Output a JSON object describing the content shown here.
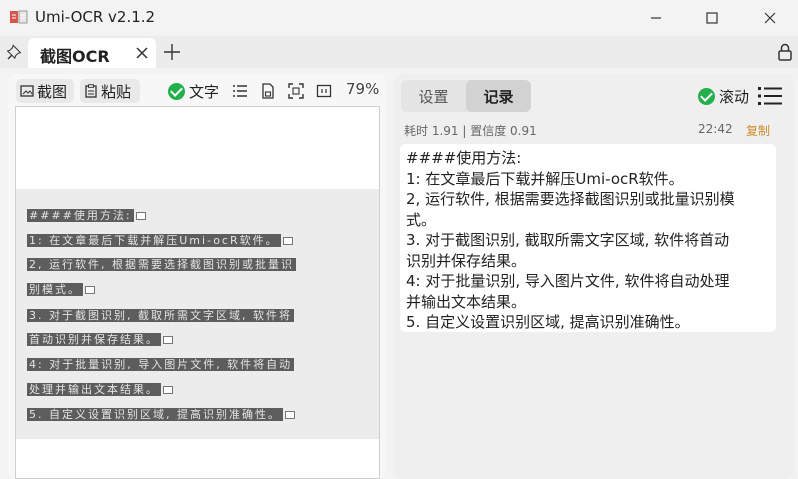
{
  "window": {
    "title": "Umi-OCR v2.1.2"
  },
  "tab": {
    "label": "截图OCR"
  },
  "left": {
    "capture_label": "截图",
    "paste_label": "粘贴",
    "text_label": "文字",
    "zoom": "79%",
    "image_lines": [
      "####使用方法:",
      "1: 在文章最后下载并解压Umi-ocR软件。",
      "2, 运行软件, 根据需要选择截图识别或批量识",
      "别模式。",
      "3. 对于截图识别, 截取所需文字区域, 软件将",
      "首动识别并保存结果。",
      "4: 对于批量识别, 导入图片文件, 软件将自动",
      "处理并输出文本结果。",
      "5. 自定义设置识别区域, 提高识别准确性。"
    ]
  },
  "right": {
    "tab_settings": "设置",
    "tab_records": "记录",
    "scroll_label": "滚动",
    "meta": "耗时 1.91 | 置信度 0.91",
    "time": "22:42",
    "copy": "复制",
    "result_lines": [
      "####使用方法:",
      "1: 在文章最后下载并解压Umi-ocR软件。",
      "2, 运行软件, 根据需要选择截图识别或批量识别模",
      "式。",
      "3. 对于截图识别, 截取所需文字区域, 软件将首动",
      "识别并保存结果。",
      "4: 对于批量识别, 导入图片文件, 软件将自动处理",
      "并输出文本结果。",
      "5. 自定义设置识别区域, 提高识别准确性。"
    ]
  },
  "colors": {
    "accent_green": "#22b04b",
    "copy_orange": "#d08a2a"
  }
}
